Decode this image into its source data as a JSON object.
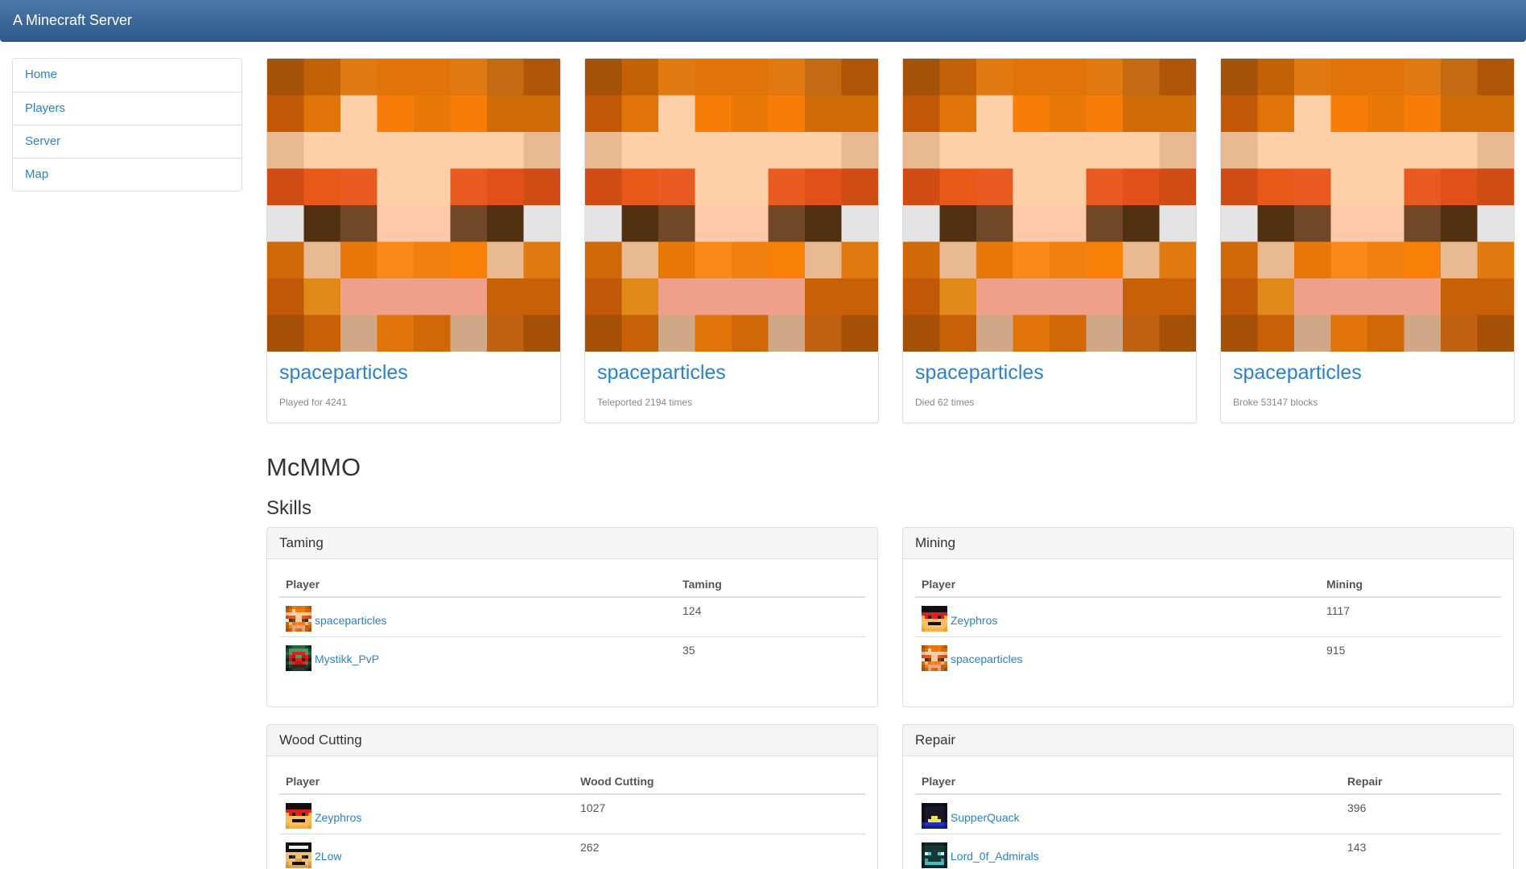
{
  "navbar": {
    "brand": "A Minecraft Server"
  },
  "sidebar": {
    "items": [
      {
        "label": "Home"
      },
      {
        "label": "Players"
      },
      {
        "label": "Server"
      },
      {
        "label": "Map"
      }
    ]
  },
  "cards": [
    {
      "player": "spaceparticles",
      "stat": "Played for 4241"
    },
    {
      "player": "spaceparticles",
      "stat": "Teleported 2194 times"
    },
    {
      "player": "spaceparticles",
      "stat": "Died 62 times"
    },
    {
      "player": "spaceparticles",
      "stat": "Broke 53147 blocks"
    }
  ],
  "headings": {
    "section": "McMMO",
    "subsection": "Skills"
  },
  "skills": [
    {
      "title": "Taming",
      "col_player": "Player",
      "col_value": "Taming",
      "rows": [
        {
          "player": "spaceparticles",
          "value": "124",
          "avatar": "orange-head"
        },
        {
          "player": "Mystikk_PvP",
          "value": "35",
          "avatar": "green-red-head"
        }
      ]
    },
    {
      "title": "Mining",
      "col_player": "Player",
      "col_value": "Mining",
      "rows": [
        {
          "player": "Zeyphros",
          "value": "1117",
          "avatar": "red-visor-head"
        },
        {
          "player": "spaceparticles",
          "value": "915",
          "avatar": "orange-head"
        }
      ]
    },
    {
      "title": "Wood Cutting",
      "col_player": "Player",
      "col_value": "Wood Cutting",
      "rows": [
        {
          "player": "Zeyphros",
          "value": "1027",
          "avatar": "red-visor-head"
        },
        {
          "player": "2Low",
          "value": "262",
          "avatar": "black-hat-head"
        }
      ]
    },
    {
      "title": "Repair",
      "col_player": "Player",
      "col_value": "Repair",
      "rows": [
        {
          "player": "SupperQuack",
          "value": "396",
          "avatar": "dark-blue-head"
        },
        {
          "player": "Lord_0f_Admirals",
          "value": "143",
          "avatar": "teal-head"
        }
      ]
    }
  ],
  "colors": {
    "link": "#2a82cc",
    "navbar": "#3a659a"
  }
}
